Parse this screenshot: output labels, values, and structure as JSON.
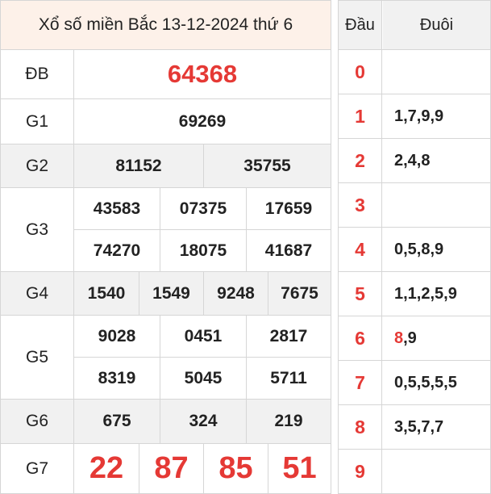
{
  "title": "Xổ số miền Bắc 13-12-2024 thứ 6",
  "prizes": {
    "db": {
      "label": "ĐB",
      "numbers": [
        "64368"
      ]
    },
    "g1": {
      "label": "G1",
      "numbers": [
        "69269"
      ]
    },
    "g2": {
      "label": "G2",
      "numbers": [
        "81152",
        "35755"
      ]
    },
    "g3": {
      "label": "G3",
      "numbers": [
        "43583",
        "07375",
        "17659",
        "74270",
        "18075",
        "41687"
      ]
    },
    "g4": {
      "label": "G4",
      "numbers": [
        "1540",
        "1549",
        "9248",
        "7675"
      ]
    },
    "g5": {
      "label": "G5",
      "numbers": [
        "9028",
        "0451",
        "2817",
        "8319",
        "5045",
        "5711"
      ]
    },
    "g6": {
      "label": "G6",
      "numbers": [
        "675",
        "324",
        "219"
      ]
    },
    "g7": {
      "label": "G7",
      "numbers": [
        "22",
        "87",
        "85",
        "51"
      ]
    }
  },
  "dau_duoi": {
    "header_dau": "Đầu",
    "header_duoi": "Đuôi",
    "rows": [
      {
        "dau": "0",
        "duoi_highlight": "",
        "duoi_rest": ""
      },
      {
        "dau": "1",
        "duoi_highlight": "",
        "duoi_rest": "1,7,9,9"
      },
      {
        "dau": "2",
        "duoi_highlight": "",
        "duoi_rest": "2,4,8"
      },
      {
        "dau": "3",
        "duoi_highlight": "",
        "duoi_rest": ""
      },
      {
        "dau": "4",
        "duoi_highlight": "",
        "duoi_rest": "0,5,8,9"
      },
      {
        "dau": "5",
        "duoi_highlight": "",
        "duoi_rest": "1,1,2,5,9"
      },
      {
        "dau": "6",
        "duoi_highlight": "8",
        "duoi_rest": ",9"
      },
      {
        "dau": "7",
        "duoi_highlight": "",
        "duoi_rest": "0,5,5,5,5"
      },
      {
        "dau": "8",
        "duoi_highlight": "",
        "duoi_rest": "3,5,7,7"
      },
      {
        "dau": "9",
        "duoi_highlight": "",
        "duoi_rest": ""
      }
    ]
  },
  "colors": {
    "accent_red": "#e53935",
    "title_bg": "#fdf1e9",
    "gray_row_bg": "#f1f1f1",
    "border": "#d6d6d6"
  }
}
